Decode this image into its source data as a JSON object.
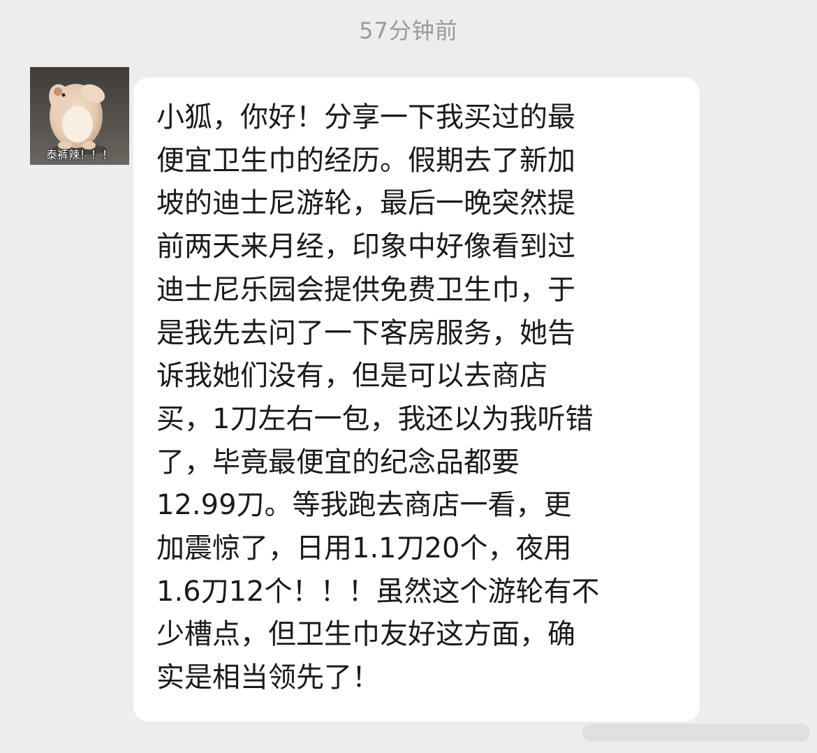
{
  "chat": {
    "timestamp": "57分钟前",
    "avatar": {
      "caption": "泰裤辣！！！",
      "icon": "hamster-avatar-icon"
    },
    "message": {
      "text": "小狐，你好！分享一下我买过的最\n便宜卫生巾的经历。假期去了新加\n坡的迪士尼游轮，最后一晚突然提\n前两天来月经，印象中好像看到过\n迪士尼乐园会提供免费卫生巾，于\n是我先去问了一下客房服务，她告\n诉我她们没有，但是可以去商店\n买，1刀左右一包，我还以为我听错\n了，毕竟最便宜的纪念品都要\n12.99刀。等我跑去商店一看，更\n加震惊了，日用1.1刀20个，夜用\n1.6刀12个！！！虽然这个游轮有不\n少槽点，但卫生巾友好这方面，确\n实是相当领先了！"
    }
  },
  "colors": {
    "background": "#ededed",
    "bubble": "#ffffff",
    "timestamp_text": "#9a9a9a",
    "message_text": "#1a1a1a"
  }
}
